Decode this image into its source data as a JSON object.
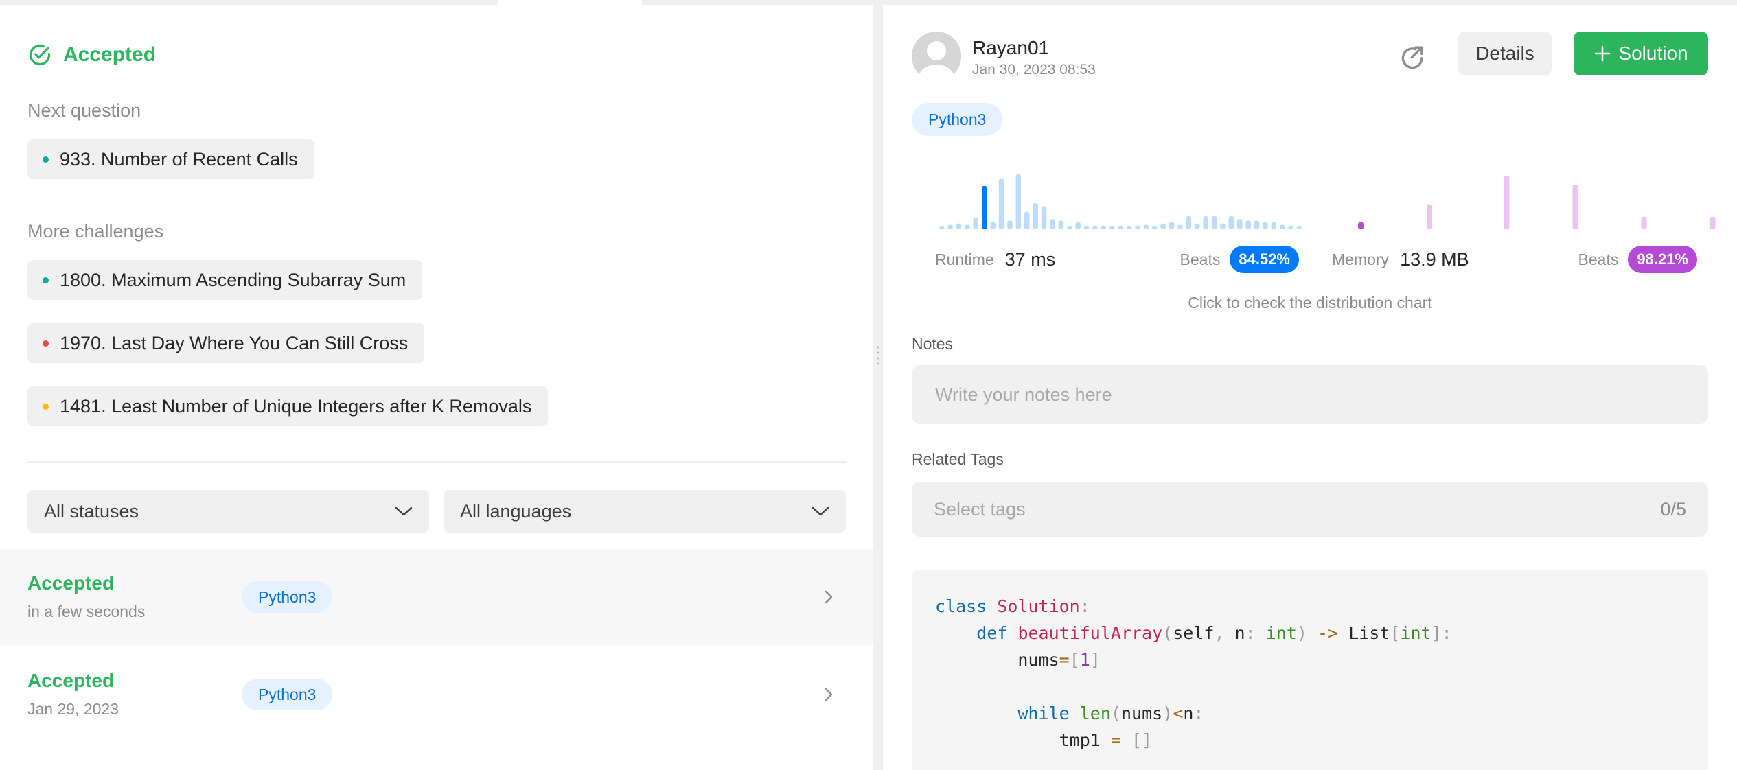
{
  "status": {
    "label": "Accepted",
    "color": "#2db55d"
  },
  "next_question": {
    "title": "Next question",
    "items": [
      {
        "label": "933. Number of Recent Calls",
        "difficulty_color": "#00af9b"
      }
    ]
  },
  "more_challenges": {
    "title": "More challenges",
    "items": [
      {
        "label": "1800. Maximum Ascending Subarray Sum",
        "difficulty_color": "#00af9b"
      },
      {
        "label": "1970. Last Day Where You Can Still Cross",
        "difficulty_color": "#ef4743"
      },
      {
        "label": "1481. Least Number of Unique Integers after K Removals",
        "difficulty_color": "#ffb800"
      }
    ]
  },
  "filters": {
    "status": "All statuses",
    "language": "All languages"
  },
  "submissions": [
    {
      "status": "Accepted",
      "time": "in a few seconds",
      "language": "Python3"
    },
    {
      "status": "Accepted",
      "time": "Jan 29, 2023",
      "language": "Python3"
    }
  ],
  "detail": {
    "username": "Rayan01",
    "date": "Jan 30, 2023 08:53",
    "details_label": "Details",
    "solution_label": "Solution",
    "solution_icon": "plus-icon",
    "share_icon": "share-icon",
    "language": "Python3",
    "runtime": {
      "label": "Runtime",
      "value": "37 ms",
      "beats_label": "Beats",
      "beats": "84.52%",
      "beats_number": 84.52,
      "color": "#007aff"
    },
    "memory": {
      "label": "Memory",
      "value": "13.9 MB",
      "beats_label": "Beats",
      "beats": "98.21%",
      "beats_number": 98.21,
      "color": "#b44ad6"
    },
    "hint": "Click to check the distribution chart",
    "notes": {
      "label": "Notes",
      "placeholder": "Write your notes here"
    },
    "tags": {
      "label": "Related Tags",
      "placeholder": "Select tags",
      "count": "0/5"
    },
    "code": [
      "class Solution:",
      "    def beautifulArray(self, n: int) -> List[int]:",
      "        nums=[1]",
      "",
      "        while len(nums)<n:",
      "            tmp1 = []"
    ]
  },
  "chart_data": [
    {
      "type": "bar",
      "name": "runtime-distribution",
      "highlight_index": 5,
      "values": [
        2,
        3,
        4,
        3,
        8,
        30,
        5,
        35,
        6,
        38,
        12,
        18,
        16,
        7,
        6,
        2,
        5,
        2,
        2,
        2,
        2,
        2,
        2,
        2,
        3,
        2,
        4,
        5,
        3,
        9,
        4,
        9,
        9,
        4,
        9,
        7,
        6,
        6,
        5,
        5,
        3,
        2,
        2
      ]
    },
    {
      "type": "bar",
      "name": "memory-distribution",
      "highlight_index": 0,
      "values": [
        4,
        0,
        0,
        0,
        0,
        0,
        0,
        0,
        14,
        0,
        0,
        0,
        0,
        0,
        0,
        0,
        0,
        30,
        0,
        0,
        0,
        0,
        0,
        0,
        0,
        25,
        0,
        0,
        0,
        0,
        0,
        0,
        0,
        7,
        0,
        0,
        0,
        0,
        0,
        0,
        0,
        7
      ]
    }
  ]
}
